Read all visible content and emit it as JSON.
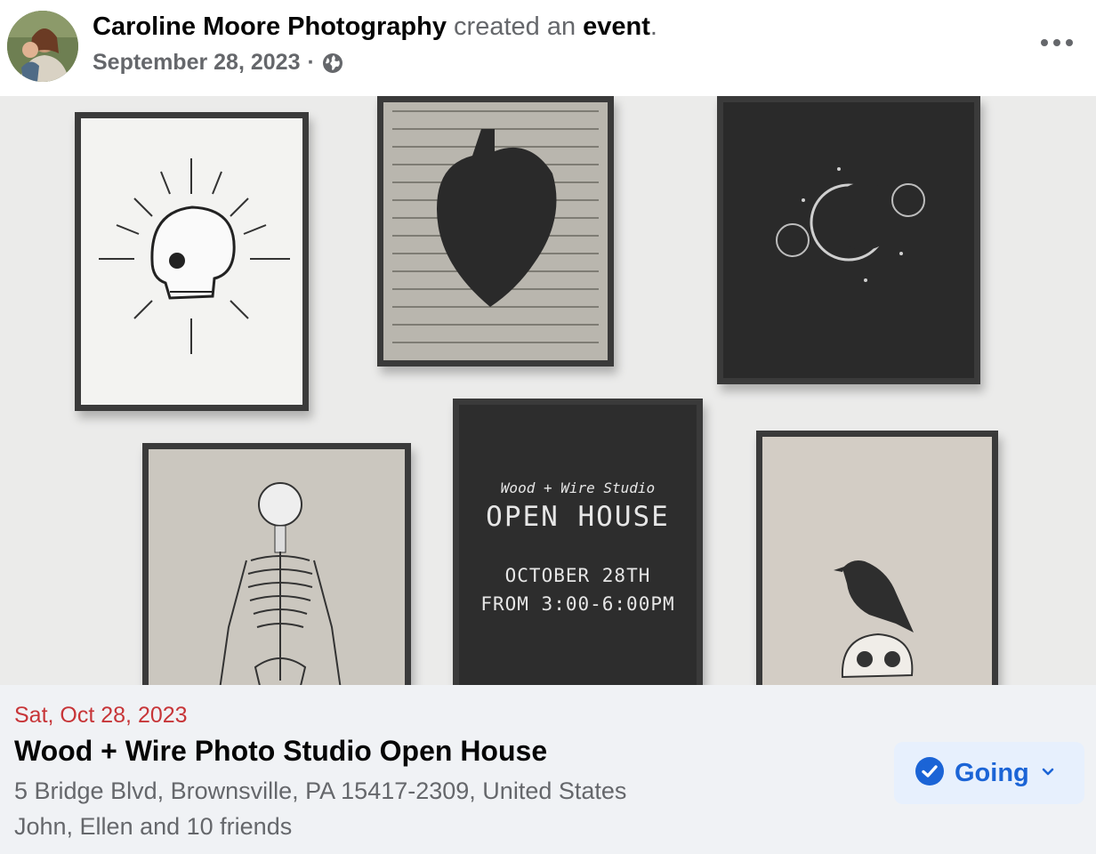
{
  "post": {
    "author": "Caroline Moore Photography",
    "action_text": "created an",
    "object_text": "event",
    "period": ".",
    "date": "September 28, 2023",
    "separator": "·",
    "privacy_icon": "globe-icon",
    "menu_icon": "more-options-icon"
  },
  "cover": {
    "poster_studio": "Wood + Wire Studio",
    "poster_heading": "OPEN HOUSE",
    "poster_date": "OCTOBER 28TH",
    "poster_time": "FROM 3:00-6:00PM"
  },
  "event": {
    "date": "Sat, Oct 28, 2023",
    "title": "Wood + Wire Photo Studio Open House",
    "address": "5 Bridge Blvd, Brownsville, PA 15417-2309, United States",
    "friends": "John, Ellen and 10 friends",
    "rsvp_label": "Going",
    "rsvp_icon": "check-circle-icon",
    "rsvp_dropdown_icon": "chevron-down-icon"
  },
  "colors": {
    "date_red": "#c73538",
    "rsvp_blue": "#1b64d6",
    "rsvp_bg": "#e7f0fd",
    "info_bg": "#f0f2f5"
  }
}
